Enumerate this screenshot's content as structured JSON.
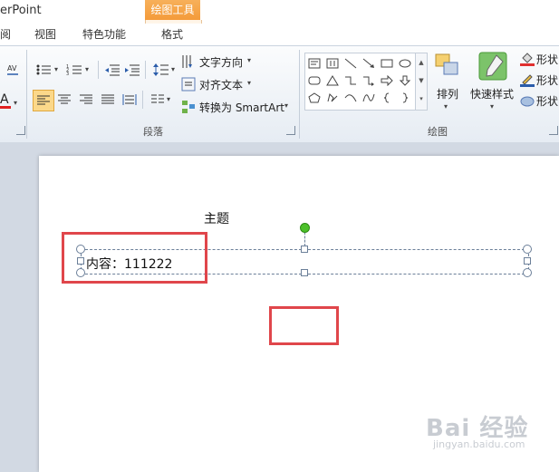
{
  "app": {
    "title_fragment": "erPoint",
    "context_tool": "绘图工具"
  },
  "tabs": [
    {
      "label": "阅",
      "active": false
    },
    {
      "label": "视图",
      "active": false
    },
    {
      "label": "特色功能",
      "active": false
    },
    {
      "label": "格式",
      "active": true
    }
  ],
  "ribbon": {
    "paragraph": {
      "label": "段落",
      "text_direction": "文字方向",
      "align_text": "对齐文本",
      "convert_smartart": "转换为 SmartArt"
    },
    "drawing": {
      "label": "绘图",
      "arrange": "排列",
      "quick_styles": "快速样式",
      "shape_fill": "形状",
      "shape_outline": "形状",
      "shape_effects": "形状"
    }
  },
  "slide": {
    "title": "主题",
    "content": "内容：111222"
  },
  "watermark": {
    "brand": "Bai 经验",
    "url": "jingyan.baidu.com"
  },
  "colors": {
    "highlight": "#e0464b",
    "accent_orange": "#f49b3a",
    "rotation_handle": "#4cc02a"
  }
}
